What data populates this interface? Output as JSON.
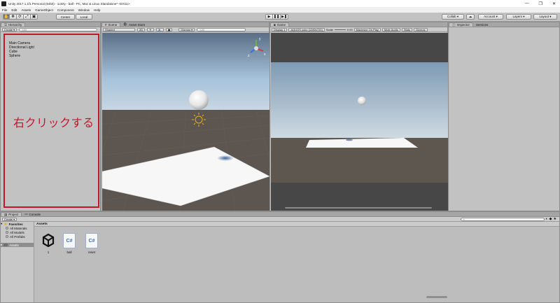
{
  "window": {
    "title": "Unity 2017.1.1f1 Personal (64bit) - 1unity - ball - PC, Mac & Linux Standalone* <DX11>",
    "controls": [
      "—",
      "❐",
      "✕"
    ]
  },
  "menu": [
    "File",
    "Edit",
    "Assets",
    "GameObject",
    "Component",
    "Window",
    "Help"
  ],
  "toolbar": {
    "tools": [
      "✋",
      "✥",
      "⟳",
      "⤢",
      "▣"
    ],
    "pivot": "Center",
    "space": "Local",
    "play": [
      "▶",
      "❚❚",
      "▶❚"
    ],
    "collab": "Collab ▾",
    "cloud": "☁",
    "account": "Account ▾",
    "layers": "Layers ▾",
    "layout": "Layout ▾"
  },
  "hierarchy": {
    "tab": "Hierarchy",
    "create": "Create ▾",
    "search_placeholder": "All",
    "items": [
      "Main Camera",
      "Directional Light",
      "Cube",
      "Sphere"
    ],
    "annotation": "右クリックする"
  },
  "scene": {
    "tabs": [
      "Scene",
      "Asset Store"
    ],
    "shading": "Shaded",
    "mode2d": "2D",
    "gizmos": "Gizmos ▾",
    "search_placeholder": "All",
    "gizmo_axis": [
      "y",
      "x",
      "z"
    ]
  },
  "game": {
    "tab": "Game",
    "display": "Display 1",
    "resolution": "AQUOS yoko (1280x720)",
    "scale_label": "Scale",
    "scale_value": "0.93",
    "toggles": [
      "Maximize On Play",
      "Mute Audio",
      "Stats",
      "Gizmos"
    ]
  },
  "inspector": {
    "tabs": [
      "Inspector",
      "Services"
    ]
  },
  "project": {
    "tabs": [
      "Project",
      "Console"
    ],
    "create": "Create ▾",
    "favorites": "Favorites",
    "favorite_items": [
      "All Materials",
      "All Models",
      "All Prefabs"
    ],
    "assets_root": "Assets",
    "assets_header": "Assets",
    "assets": [
      {
        "label": "1",
        "kind": "unity-scene"
      },
      {
        "label": "ball",
        "kind": "csharp"
      },
      {
        "label": "reset",
        "kind": "csharp"
      }
    ],
    "csharp_glyph": "C#"
  },
  "colors": {
    "annotation": "#c4162b",
    "panel": "#c2c2c2",
    "sky": "#9fc7e6",
    "ground": "#5e5750"
  }
}
